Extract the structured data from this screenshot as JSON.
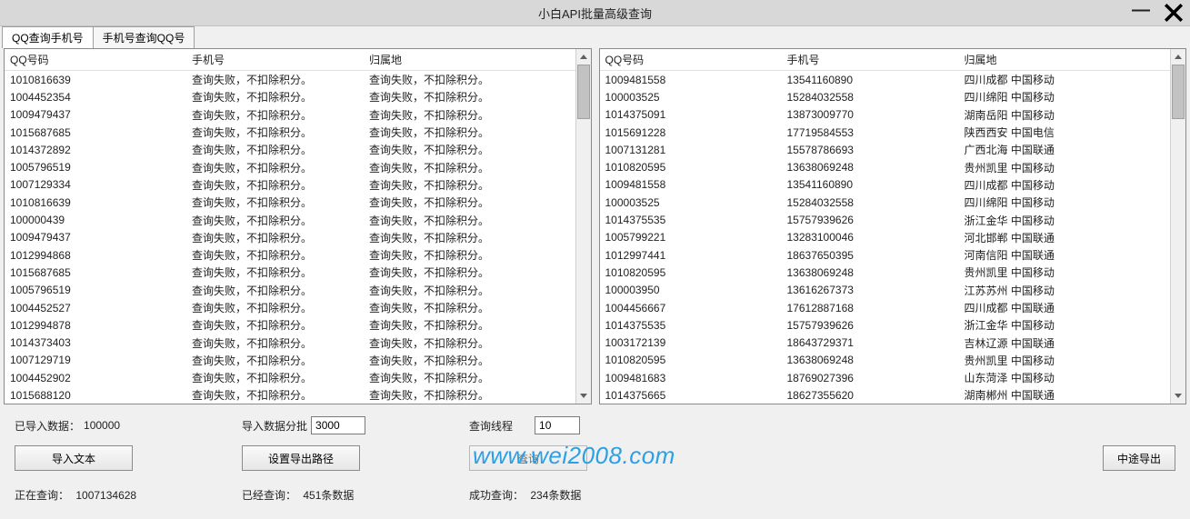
{
  "title": "小白API批量高级查询",
  "tabs": [
    "QQ查询手机号",
    "手机号查询QQ号"
  ],
  "activeTab": 0,
  "columns": {
    "qq": "QQ号码",
    "phone": "手机号",
    "loc": "归属地"
  },
  "leftRows": [
    {
      "qq": "1010816639",
      "phone": "查询失败，不扣除积分。",
      "loc": "查询失败，不扣除积分。"
    },
    {
      "qq": "1004452354",
      "phone": "查询失败，不扣除积分。",
      "loc": "查询失败，不扣除积分。"
    },
    {
      "qq": "1009479437",
      "phone": "查询失败，不扣除积分。",
      "loc": "查询失败，不扣除积分。"
    },
    {
      "qq": "1015687685",
      "phone": "查询失败，不扣除积分。",
      "loc": "查询失败，不扣除积分。"
    },
    {
      "qq": "1014372892",
      "phone": "查询失败，不扣除积分。",
      "loc": "查询失败，不扣除积分。"
    },
    {
      "qq": "1005796519",
      "phone": "查询失败，不扣除积分。",
      "loc": "查询失败，不扣除积分。"
    },
    {
      "qq": "1007129334",
      "phone": "查询失败，不扣除积分。",
      "loc": "查询失败，不扣除积分。"
    },
    {
      "qq": "1010816639",
      "phone": "查询失败，不扣除积分。",
      "loc": "查询失败，不扣除积分。"
    },
    {
      "qq": "100000439",
      "phone": "查询失败，不扣除积分。",
      "loc": "查询失败，不扣除积分。"
    },
    {
      "qq": "1009479437",
      "phone": "查询失败，不扣除积分。",
      "loc": "查询失败，不扣除积分。"
    },
    {
      "qq": "1012994868",
      "phone": "查询失败，不扣除积分。",
      "loc": "查询失败，不扣除积分。"
    },
    {
      "qq": "1015687685",
      "phone": "查询失败，不扣除积分。",
      "loc": "查询失败，不扣除积分。"
    },
    {
      "qq": "1005796519",
      "phone": "查询失败，不扣除积分。",
      "loc": "查询失败，不扣除积分。"
    },
    {
      "qq": "1004452527",
      "phone": "查询失败，不扣除积分。",
      "loc": "查询失败，不扣除积分。"
    },
    {
      "qq": "1012994878",
      "phone": "查询失败，不扣除积分。",
      "loc": "查询失败，不扣除积分。"
    },
    {
      "qq": "1014373403",
      "phone": "查询失败，不扣除积分。",
      "loc": "查询失败，不扣除积分。"
    },
    {
      "qq": "1007129719",
      "phone": "查询失败，不扣除积分。",
      "loc": "查询失败，不扣除积分。"
    },
    {
      "qq": "1004452902",
      "phone": "查询失败，不扣除积分。",
      "loc": "查询失败，不扣除积分。"
    },
    {
      "qq": "1015688120",
      "phone": "查询失败，不扣除积分。",
      "loc": "查询失败，不扣除积分。"
    }
  ],
  "rightRows": [
    {
      "qq": "1009481558",
      "phone": "13541160890",
      "loc": "四川成都 中国移动"
    },
    {
      "qq": "100003525",
      "phone": "15284032558",
      "loc": "四川绵阳 中国移动"
    },
    {
      "qq": "1014375091",
      "phone": "13873009770",
      "loc": "湖南岳阳 中国移动"
    },
    {
      "qq": "1015691228",
      "phone": "17719584553",
      "loc": "陕西西安 中国电信"
    },
    {
      "qq": "1007131281",
      "phone": "15578786693",
      "loc": "广西北海 中国联通"
    },
    {
      "qq": "1010820595",
      "phone": "13638069248",
      "loc": "贵州凯里 中国移动"
    },
    {
      "qq": "1009481558",
      "phone": "13541160890",
      "loc": "四川成都 中国移动"
    },
    {
      "qq": "100003525",
      "phone": "15284032558",
      "loc": "四川绵阳 中国移动"
    },
    {
      "qq": "1014375535",
      "phone": "15757939626",
      "loc": "浙江金华 中国移动"
    },
    {
      "qq": "1005799221",
      "phone": "13283100046",
      "loc": "河北邯郸 中国联通"
    },
    {
      "qq": "1012997441",
      "phone": "18637650395",
      "loc": "河南信阳 中国联通"
    },
    {
      "qq": "1010820595",
      "phone": "13638069248",
      "loc": "贵州凯里 中国移动"
    },
    {
      "qq": "100003950",
      "phone": "13616267373",
      "loc": "江苏苏州 中国移动"
    },
    {
      "qq": "1004456667",
      "phone": "17612887168",
      "loc": "四川成都 中国联通"
    },
    {
      "qq": "1014375535",
      "phone": "15757939626",
      "loc": "浙江金华 中国移动"
    },
    {
      "qq": "1003172139",
      "phone": "18643729371",
      "loc": "吉林辽源 中国联通"
    },
    {
      "qq": "1010820595",
      "phone": "13638069248",
      "loc": "贵州凯里 中国移动"
    },
    {
      "qq": "1009481683",
      "phone": "18769027396",
      "loc": "山东菏泽 中国移动"
    },
    {
      "qq": "1014375665",
      "phone": "18627355620",
      "loc": "湖南郴州 中国联通"
    }
  ],
  "footer": {
    "importedLabel": "已导入数据：",
    "importedValue": "100000",
    "batchLabel": "导入数据分批",
    "batchValue": "3000",
    "threadLabel": "查询线程",
    "threadValue": "10",
    "btnImport": "导入文本",
    "btnExportPath": "设置导出路径",
    "btnQuery": "查询",
    "btnStopExport": "中途导出",
    "queryingLabel": "正在查询：",
    "queryingValue": "1007134628",
    "doneLabel": "已经查询：",
    "doneValue": "451条数据",
    "successLabel": "成功查询：",
    "successValue": "234条数据"
  },
  "watermark": "www.wei2008.com"
}
